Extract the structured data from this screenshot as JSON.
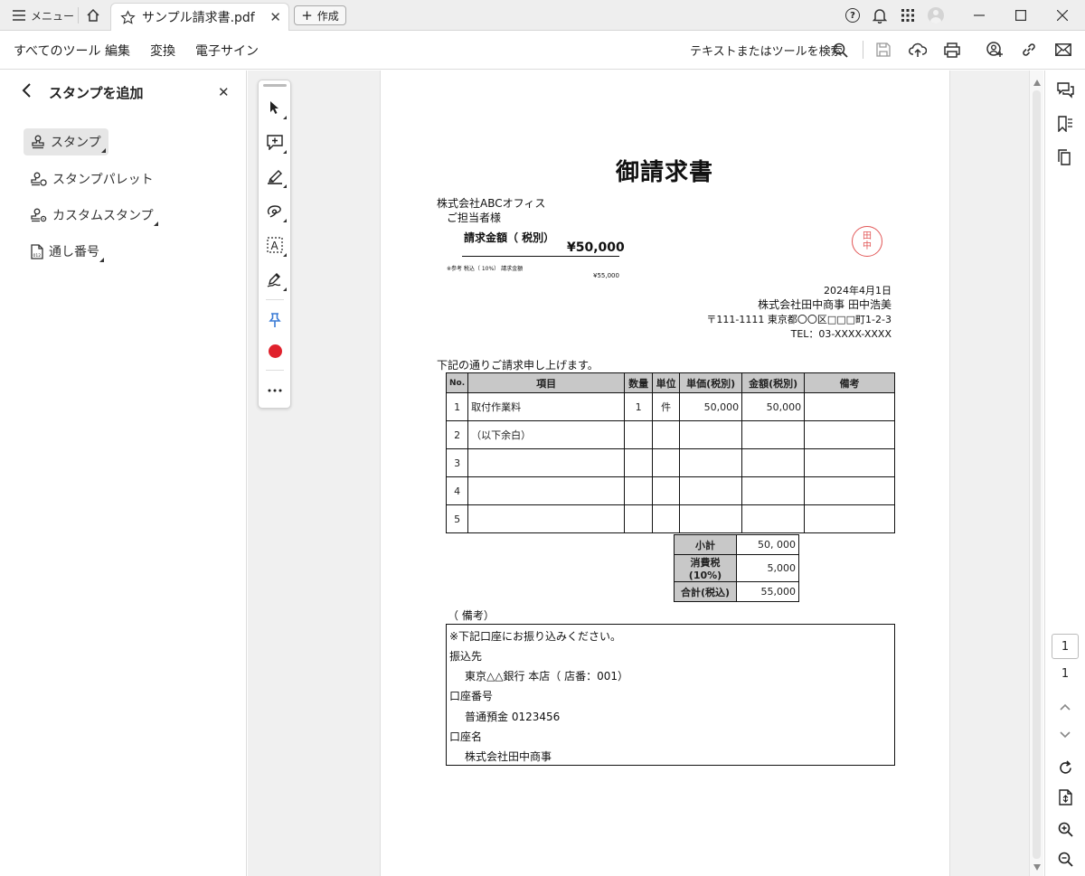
{
  "titlebar": {
    "menu_label": "メニュー",
    "tab_title": "サンプル請求書.pdf",
    "create_label": "作成"
  },
  "menubar": {
    "items": [
      "すべてのツール",
      "編集",
      "変換",
      "電子サイン"
    ],
    "search_label": "テキストまたはツールを検索"
  },
  "left_panel": {
    "title": "スタンプを追加",
    "items": [
      "スタンプ",
      "スタンプパレット",
      "カスタムスタンプ",
      "通し番号"
    ]
  },
  "colors": {
    "accent_red": "#e0212c",
    "stamp_red": "#e25656",
    "pin_blue": "#3a7bd5",
    "table_header": "#c8c8c8"
  },
  "invoice": {
    "title": "御請求書",
    "recipient_company": "株式会社ABCオフィス",
    "recipient_person": "ご担当者様",
    "amount_label": "請求金額（ 税別）",
    "amount_value": "¥50,000",
    "tax_note": "※参考 税込（ 10%） 請求金額",
    "tax_note_value": "¥55,000",
    "stamp_chars": [
      "田",
      "中"
    ],
    "date": "2024年4月1日",
    "issuer": "株式会社田中商事 田中浩美",
    "address": "〒111-1111 東京都〇〇区□□□町1-2-3",
    "tel": "TEL：03-XXXX-XXXX",
    "intro": "下記の通りご請求申し上げます。",
    "table_headers": [
      "No.",
      "項目",
      "数量",
      "単位",
      "単価(税別)",
      "金額(税別)",
      "備考"
    ],
    "rows": [
      {
        "no": "1",
        "item": "取付作業料",
        "qty": "1",
        "unit": "件",
        "price": "50,000",
        "amount": "50,000",
        "note": ""
      },
      {
        "no": "2",
        "item": "（以下余白）",
        "qty": "",
        "unit": "",
        "price": "",
        "amount": "",
        "note": ""
      },
      {
        "no": "3",
        "item": "",
        "qty": "",
        "unit": "",
        "price": "",
        "amount": "",
        "note": ""
      },
      {
        "no": "4",
        "item": "",
        "qty": "",
        "unit": "",
        "price": "",
        "amount": "",
        "note": ""
      },
      {
        "no": "5",
        "item": "",
        "qty": "",
        "unit": "",
        "price": "",
        "amount": "",
        "note": ""
      }
    ],
    "totals": [
      {
        "label": "小計",
        "value": "50, 000"
      },
      {
        "label": "消費税(10%)",
        "value": "5,000"
      },
      {
        "label": "合計(税込)",
        "value": "55,000"
      }
    ],
    "remarks_label": "（ 備考）",
    "remarks": [
      "※下記口座にお振り込みください。",
      "振込先",
      "東京△△銀行 本店（ 店番：001）",
      "口座番号",
      "普通預金 0123456",
      "口座名",
      "株式会社田中商事"
    ]
  },
  "pagination": {
    "current": "1",
    "total": "1"
  }
}
